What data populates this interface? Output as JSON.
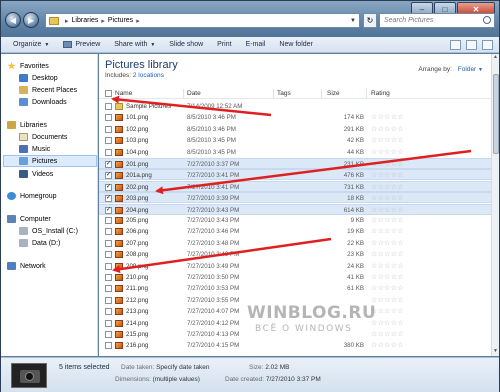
{
  "address": {
    "crumbs": [
      "Libraries",
      "Pictures"
    ],
    "search_placeholder": "Search Pictures"
  },
  "toolbar": {
    "organize": "Organize",
    "preview": "Preview",
    "share_with": "Share with",
    "slide_show": "Slide show",
    "print": "Print",
    "email": "E-mail",
    "new_folder": "New folder"
  },
  "nav": {
    "favorites": "Favorites",
    "desktop": "Desktop",
    "recent_places": "Recent Places",
    "downloads": "Downloads",
    "libraries": "Libraries",
    "documents": "Documents",
    "music": "Music",
    "pictures": "Pictures",
    "videos": "Videos",
    "homegroup": "Homegroup",
    "computer": "Computer",
    "drive_c": "OS_Install (C:)",
    "drive_d": "Data (D:)",
    "network": "Network"
  },
  "library": {
    "title": "Pictures library",
    "includes_label": "Includes:",
    "includes_link": "2 locations",
    "arrange_label": "Arrange by:",
    "arrange_value": "Folder"
  },
  "columns": {
    "name": "Name",
    "date": "Date",
    "tags": "Tags",
    "size": "Size",
    "rating": "Rating"
  },
  "files": [
    {
      "name": "Sample Pictures",
      "date": "7/14/2009 12:52 AM",
      "size": "",
      "folder": true,
      "selected": false,
      "checked": false
    },
    {
      "name": "101.png",
      "date": "8/5/2010 3:46 PM",
      "size": "174 KB",
      "folder": false,
      "selected": false,
      "checked": false
    },
    {
      "name": "102.png",
      "date": "8/5/2010 3:46 PM",
      "size": "291 KB",
      "folder": false,
      "selected": false,
      "checked": false
    },
    {
      "name": "103.png",
      "date": "8/5/2010 3:45 PM",
      "size": "42 KB",
      "folder": false,
      "selected": false,
      "checked": false
    },
    {
      "name": "104.png",
      "date": "8/5/2010 3:45 PM",
      "size": "44 KB",
      "folder": false,
      "selected": false,
      "checked": false
    },
    {
      "name": "201.png",
      "date": "7/27/2010 3:37 PM",
      "size": "231 KB",
      "folder": false,
      "selected": true,
      "checked": true
    },
    {
      "name": "201a.png",
      "date": "7/27/2010 3:41 PM",
      "size": "476 KB",
      "folder": false,
      "selected": true,
      "checked": true
    },
    {
      "name": "202.png",
      "date": "7/27/2010 3:41 PM",
      "size": "731 KB",
      "folder": false,
      "selected": true,
      "checked": true
    },
    {
      "name": "203.png",
      "date": "7/27/2010 3:39 PM",
      "size": "18 KB",
      "folder": false,
      "selected": true,
      "checked": true
    },
    {
      "name": "204.png",
      "date": "7/27/2010 3:43 PM",
      "size": "614 KB",
      "folder": false,
      "selected": true,
      "checked": true
    },
    {
      "name": "205.png",
      "date": "7/27/2010 3:43 PM",
      "size": "9 KB",
      "folder": false,
      "selected": false,
      "checked": false
    },
    {
      "name": "206.png",
      "date": "7/27/2010 3:46 PM",
      "size": "19 KB",
      "folder": false,
      "selected": false,
      "checked": false
    },
    {
      "name": "207.png",
      "date": "7/27/2010 3:48 PM",
      "size": "22 KB",
      "folder": false,
      "selected": false,
      "checked": false
    },
    {
      "name": "208.png",
      "date": "7/27/2010 3:48 PM",
      "size": "23 KB",
      "folder": false,
      "selected": false,
      "checked": false
    },
    {
      "name": "209.png",
      "date": "7/27/2010 3:49 PM",
      "size": "24 KB",
      "folder": false,
      "selected": false,
      "checked": false
    },
    {
      "name": "210.png",
      "date": "7/27/2010 3:50 PM",
      "size": "41 KB",
      "folder": false,
      "selected": false,
      "checked": false
    },
    {
      "name": "211.png",
      "date": "7/27/2010 3:53 PM",
      "size": "61 KB",
      "folder": false,
      "selected": false,
      "checked": false
    },
    {
      "name": "212.png",
      "date": "7/27/2010 3:55 PM",
      "size": "",
      "folder": false,
      "selected": false,
      "checked": false
    },
    {
      "name": "213.png",
      "date": "7/27/2010 4:07 PM",
      "size": "",
      "folder": false,
      "selected": false,
      "checked": false
    },
    {
      "name": "214.png",
      "date": "7/27/2010 4:12 PM",
      "size": "",
      "folder": false,
      "selected": false,
      "checked": false
    },
    {
      "name": "215.png",
      "date": "7/27/2010 4:13 PM",
      "size": "",
      "folder": false,
      "selected": false,
      "checked": false
    },
    {
      "name": "216.png",
      "date": "7/27/2010 4:15 PM",
      "size": "380 KB",
      "folder": false,
      "selected": false,
      "checked": false
    }
  ],
  "details": {
    "selected_count": "5 items selected",
    "date_taken_label": "Date taken:",
    "date_taken_value": "Specify date taken",
    "dimensions_label": "Dimensions:",
    "dimensions_value": "(multiple values)",
    "size_label": "Size:",
    "size_value": "2.02 MB",
    "date_created_label": "Date created:",
    "date_created_value": "7/27/2010 3:37 PM"
  },
  "watermark": {
    "title": "WINBLOG.RU",
    "subtitle": "ВСЁ О WINDOWS"
  },
  "colors": {
    "title_blue": "#1e3a6e",
    "link_blue": "#1d5fb9",
    "selection": "#dbe8f7",
    "arrow_red": "#e02020"
  }
}
